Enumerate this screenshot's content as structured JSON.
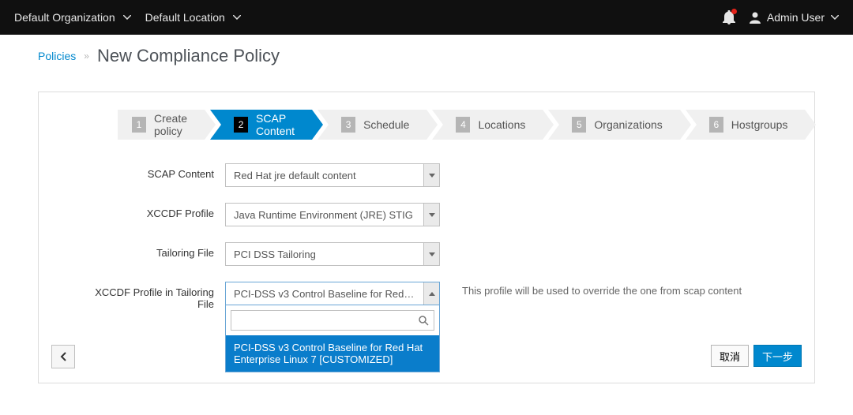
{
  "topbar": {
    "org": "Default Organization",
    "loc": "Default Location",
    "user": "Admin User"
  },
  "breadcrumbs": {
    "parent": "Policies",
    "title": "New Compliance Policy"
  },
  "wizard": {
    "steps": [
      {
        "num": "1",
        "label": "Create policy"
      },
      {
        "num": "2",
        "label": "SCAP Content"
      },
      {
        "num": "3",
        "label": "Schedule"
      },
      {
        "num": "4",
        "label": "Locations"
      },
      {
        "num": "5",
        "label": "Organizations"
      },
      {
        "num": "6",
        "label": "Hostgroups"
      }
    ]
  },
  "form": {
    "scap_content": {
      "label": "SCAP Content",
      "value": "Red Hat jre default content"
    },
    "xccdf_profile": {
      "label": "XCCDF Profile",
      "value": "Java Runtime Environment (JRE) STIG"
    },
    "tailoring_file": {
      "label": "Tailoring File",
      "value": "PCI DSS Tailoring"
    },
    "xccdf_tailoring": {
      "label": "XCCDF Profile in Tailoring File",
      "value": "PCI-DSS v3 Control Baseline for Red H...",
      "help": "This profile will be used to override the one from scap content",
      "search_placeholder": "",
      "options": [
        "PCI-DSS v3 Control Baseline for Red Hat Enterprise Linux 7 [CUSTOMIZED]"
      ]
    }
  },
  "buttons": {
    "cancel": "取消",
    "next": "下一步"
  }
}
